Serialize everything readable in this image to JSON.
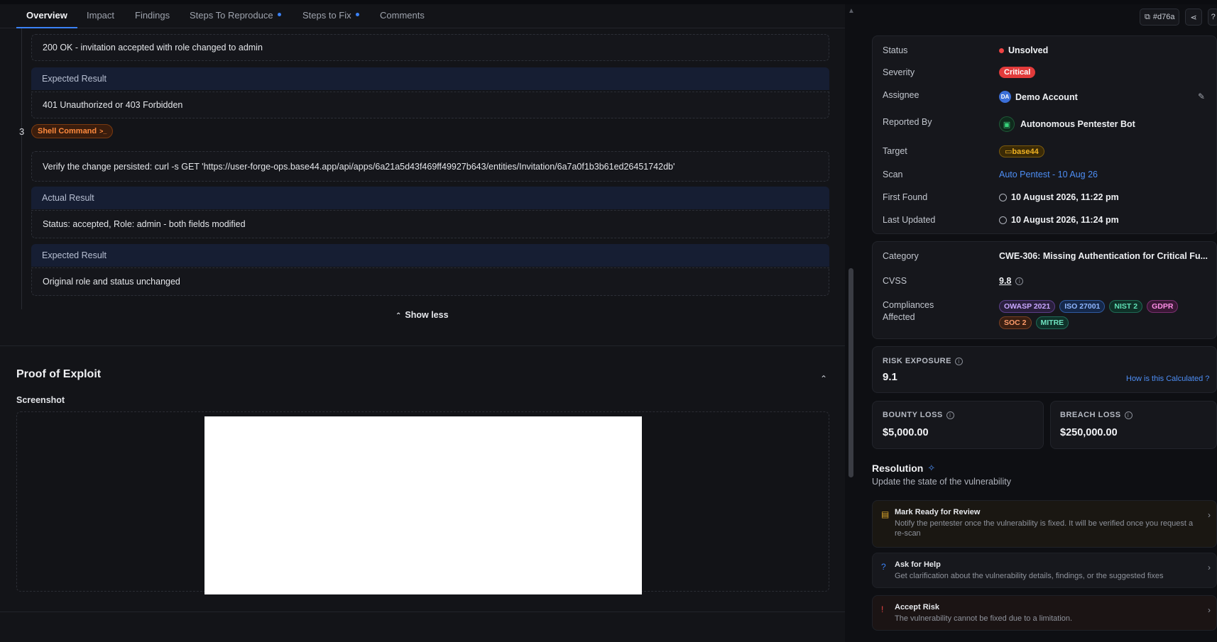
{
  "tabs": [
    {
      "label": "Overview",
      "active": true,
      "dot": false
    },
    {
      "label": "Impact",
      "active": false,
      "dot": false
    },
    {
      "label": "Findings",
      "active": false,
      "dot": false
    },
    {
      "label": "Steps To Reproduce",
      "active": false,
      "dot": true
    },
    {
      "label": "Steps to Fix",
      "active": false,
      "dot": true
    },
    {
      "label": "Comments",
      "active": false,
      "dot": false
    }
  ],
  "steps": {
    "prev_actual_result": "200 OK - invitation accepted with role changed to admin",
    "prev_expected_head": "Expected Result",
    "prev_expected_result": "401 Unauthorized or 403 Forbidden",
    "step3_number": "3",
    "step3_badge": "Shell Command",
    "step3_badge_glyph": ">_",
    "step3_command": "Verify the change persisted: curl -s GET 'https://user-forge-ops.base44.app/api/apps/6a21a5d43f469ff49927b643/entities/Invitation/6a7a0f1b3b61ed26451742db'",
    "step3_actual_head": "Actual Result",
    "step3_actual_result": "Status: accepted, Role: admin - both fields modified",
    "step3_expected_head": "Expected Result",
    "step3_expected_result": "Original role and status unchanged",
    "show_less": "Show less"
  },
  "proof": {
    "title": "Proof of Exploit",
    "screenshot_label": "Screenshot"
  },
  "header_actions": {
    "id_chip": "#d76a"
  },
  "details": {
    "status_label": "Status",
    "status_value": "Unsolved",
    "severity_label": "Severity",
    "severity_value": "Critical",
    "assignee_label": "Assignee",
    "assignee_initials": "DA",
    "assignee_value": "Demo Account",
    "reported_label": "Reported By",
    "reported_value": "Autonomous Pentester Bot",
    "target_label": "Target",
    "target_value": "base44",
    "scan_label": "Scan",
    "scan_value": "Auto Pentest - 10 Aug 26",
    "first_found_label": "First Found",
    "first_found_value": "10 August 2026, 11:22 pm",
    "last_updated_label": "Last Updated",
    "last_updated_value": "10 August 2026, 11:24 pm"
  },
  "classification": {
    "category_label": "Category",
    "category_value": "CWE-306: Missing Authentication for Critical Fu...",
    "cvss_label": "CVSS",
    "cvss_value": "9.8",
    "compliances_label_1": "Compliances",
    "compliances_label_2": "Affected",
    "tags": [
      {
        "label": "OWASP 2021",
        "bg": "#2a1f3d",
        "fg": "#c9a7ff",
        "border": "#5b3f8a"
      },
      {
        "label": "ISO 27001",
        "bg": "#15284a",
        "fg": "#8fb6ff",
        "border": "#2f5aa0"
      },
      {
        "label": "NIST 2",
        "bg": "#0f3128",
        "fg": "#5fe0b5",
        "border": "#1f6a55"
      },
      {
        "label": "GDPR",
        "bg": "#3a1735",
        "fg": "#ff8ee6",
        "border": "#7a2f70"
      },
      {
        "label": "SOC 2",
        "bg": "#3a1f12",
        "fg": "#ff9c6b",
        "border": "#7a4024"
      },
      {
        "label": "MITRE",
        "bg": "#0f3129",
        "fg": "#6fe3c0",
        "border": "#1f6a57"
      }
    ]
  },
  "risk": {
    "label": "RISK EXPOSURE",
    "value": "9.1",
    "how_link": "How is this Calculated ?"
  },
  "losses": {
    "bounty_label": "BOUNTY LOSS",
    "bounty_value": "$5,000.00",
    "breach_label": "BREACH LOSS",
    "breach_value": "$250,000.00"
  },
  "resolution": {
    "title": "Resolution",
    "subtitle": "Update the state of the vulnerability",
    "actions": [
      {
        "title": "Mark Ready for Review",
        "desc": "Notify the pentester once the vulnerability is fixed. It will be verified once you request a re-scan",
        "color": "#d9a42a"
      },
      {
        "title": "Ask for Help",
        "desc": "Get clarification about the vulnerability details, findings, or the suggested fixes",
        "color": "#3b82f6"
      },
      {
        "title": "Accept Risk",
        "desc": "The vulnerability cannot be fixed due to a limitation.",
        "color": "#ef4444"
      }
    ]
  }
}
